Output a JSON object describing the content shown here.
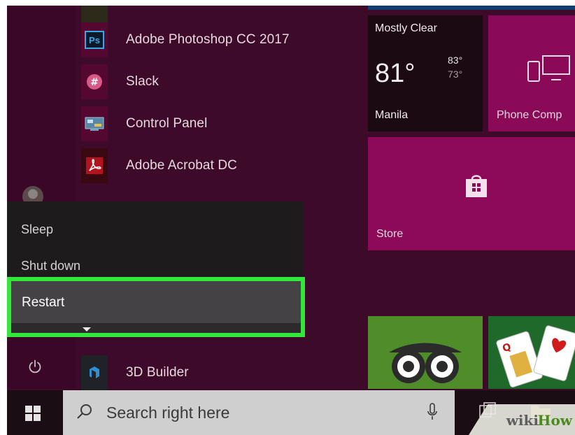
{
  "start_menu": {
    "apps": [
      {
        "label": "Adobe Photoshop CC 2017",
        "icon": "photoshop-icon",
        "icon_text": "Ps"
      },
      {
        "label": "Slack",
        "icon": "slack-icon"
      },
      {
        "label": "Control Panel",
        "icon": "control-panel-icon"
      },
      {
        "label": "Adobe Acrobat DC",
        "icon": "acrobat-icon"
      },
      {
        "label": "3D Builder",
        "icon": "3d-builder-icon"
      }
    ]
  },
  "power_menu": {
    "items": [
      {
        "label": "Sleep"
      },
      {
        "label": "Shut down"
      },
      {
        "label": "Restart"
      }
    ],
    "highlight_color": "#33e63a"
  },
  "tiles": {
    "weather": {
      "condition": "Mostly Clear",
      "temp": "81°",
      "high": "83°",
      "low": "73°",
      "city": "Manila"
    },
    "phone": {
      "label": "Phone Comp"
    },
    "store": {
      "label": "Store"
    }
  },
  "taskbar": {
    "search_placeholder": "Search right here"
  },
  "watermark": {
    "part1": "wiki",
    "part2": "How"
  },
  "colors": {
    "background": "#3e0a29",
    "tile_accent": "#8d0a59",
    "taskbar": "#1a0d13"
  }
}
